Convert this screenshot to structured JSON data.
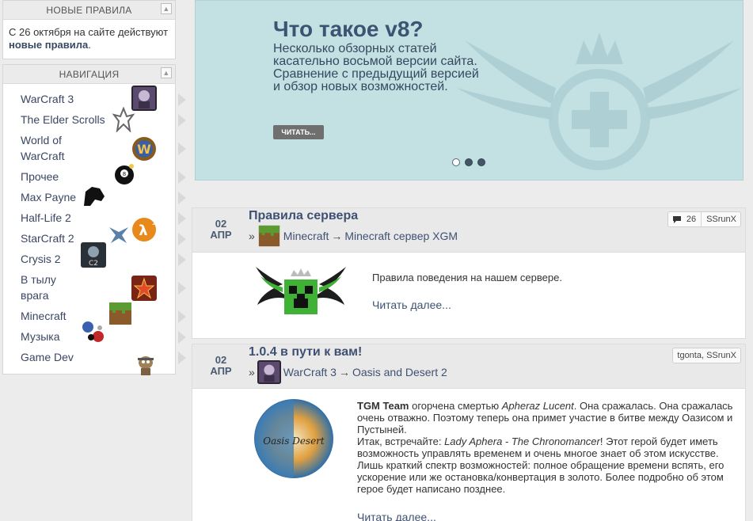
{
  "sidebar": {
    "rules": {
      "title": "НОВЫЕ ПРАВИЛА",
      "text_before": "С 26 октября на сайте действуют ",
      "link": "новые правила",
      "text_after": "."
    },
    "nav": {
      "title": "НАВИГАЦИЯ",
      "items": [
        {
          "label": "WarCraft 3"
        },
        {
          "label": "The Elder Scrolls"
        },
        {
          "label": "World of WarCraft"
        },
        {
          "label": "Прочее"
        },
        {
          "label": "Max Payne"
        },
        {
          "label": "Half-Life 2"
        },
        {
          "label": "StarCraft 2"
        },
        {
          "label": "Crysis 2"
        },
        {
          "label": "В тылу врага"
        },
        {
          "label": "Minecraft"
        },
        {
          "label": "Музыка"
        },
        {
          "label": "Game Dev"
        }
      ]
    }
  },
  "slider": {
    "title": "Что такое v8?",
    "text": "Несколько обзорных статей касательно восьмой версии сайта. Сравнение с предыдущий версией и обзор новых возможностей.",
    "button": "ЧИТАТЬ...",
    "active_slide": 1,
    "slide_count": 3
  },
  "posts": [
    {
      "day": "02",
      "month": "АПР",
      "title": "Правила сервера",
      "cat_prefix": "»",
      "category": "Minecraft",
      "arrow": "→",
      "subcategory": "Minecraft сервер XGM",
      "comments": "26",
      "authors": "SSrunX",
      "text": "Правила поведения на нашем сервере.",
      "readmore": "Читать далее..."
    },
    {
      "day": "02",
      "month": "АПР",
      "title": "1.0.4 в пути к вам!",
      "cat_prefix": "»",
      "category": "WarCraft 3",
      "arrow": "→",
      "subcategory": "Oasis and Desert 2",
      "authors": "tgonta, SSrunX",
      "team": "TGM Team",
      "p1a": " огорчена смертью ",
      "p1b": "Apheraz Lucent",
      "p1c": ". Она сражалась. Она сражалась очень отважно. Поэтому теперь она примет участие в битве между Оазисом и Пустыней.",
      "p2a": "Итак, встречайте: ",
      "p2b": "Lady Aphera - The Chronomancer",
      "p2c": "! Этот герой будет иметь возможность управлять временем и очень многое знает об этом искусстве. Лишь краткий спектр возможностей: полное обращение времени вспять, его ускорение или же остановка/конвертация в золото. Более подробно об этом герое будет написано позднее.",
      "readmore": "Читать далее...",
      "logo_text": "Oasis Desert"
    }
  ]
}
